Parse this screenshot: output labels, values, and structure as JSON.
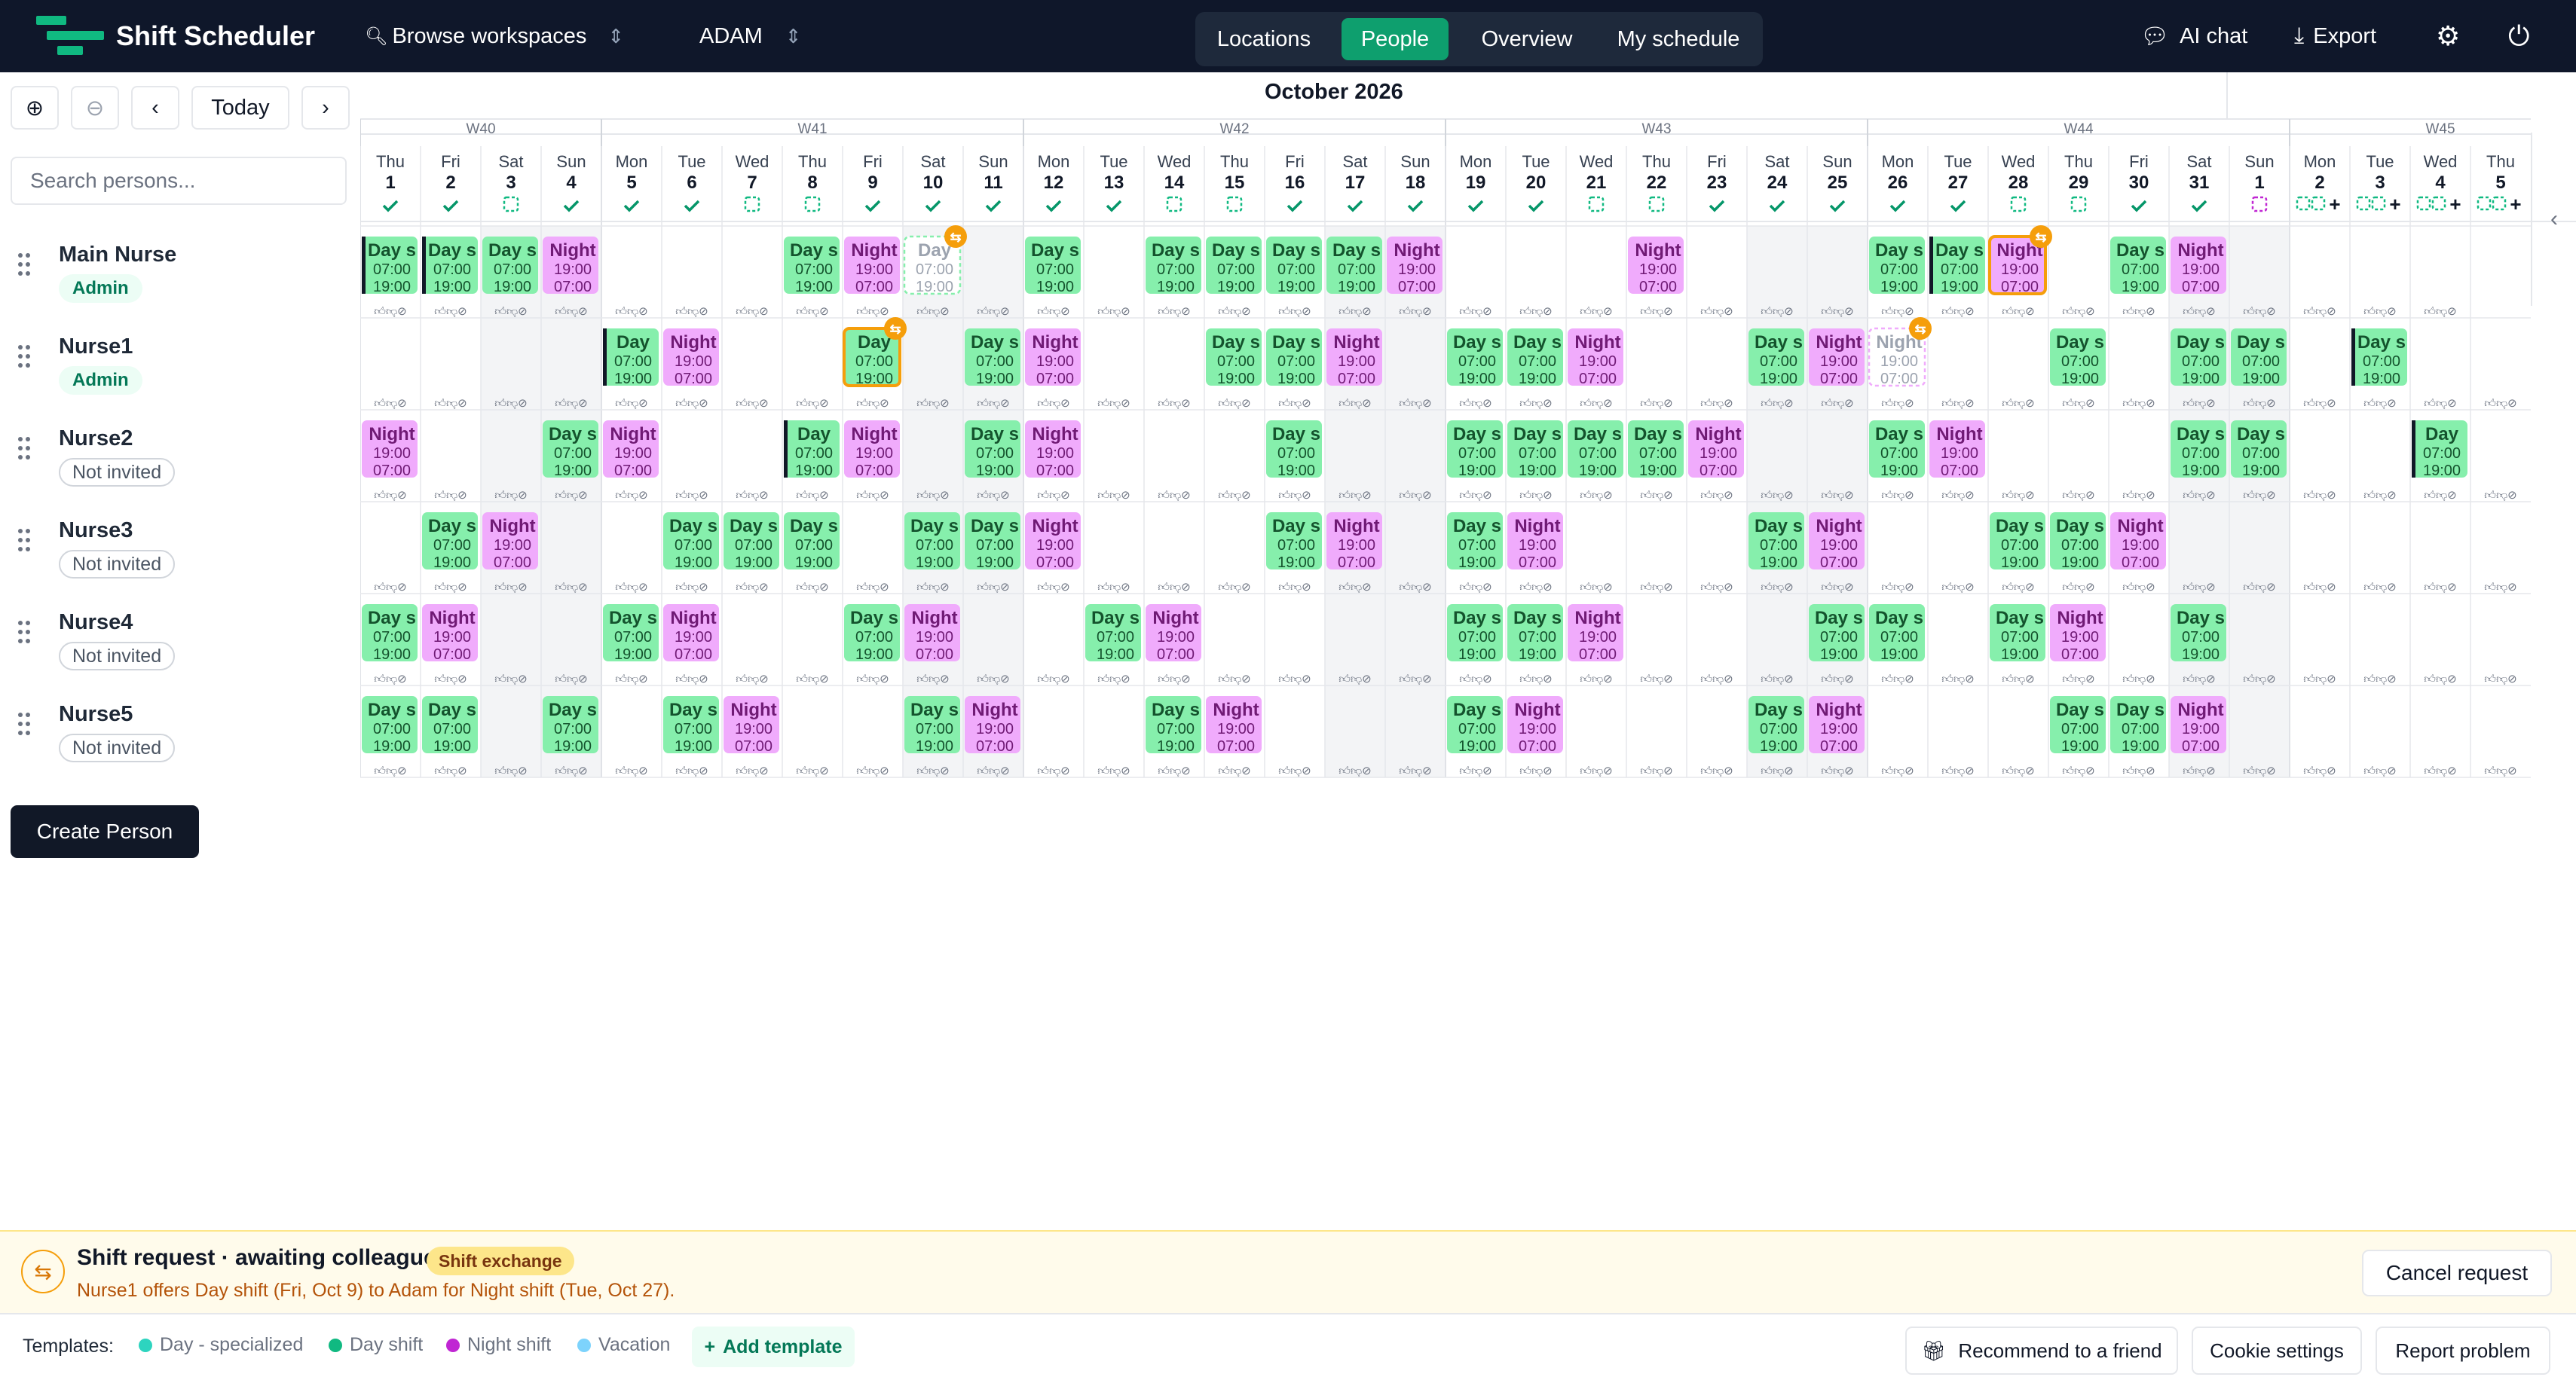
{
  "app": {
    "title": "Shift Scheduler"
  },
  "topbar": {
    "workspace_label": "Browse workspaces",
    "account_label": "ADAM",
    "ai_chat_label": "AI chat",
    "export_label": "Export"
  },
  "nav": {
    "tabs": [
      "Locations",
      "People",
      "Overview",
      "My schedule"
    ],
    "active": "People"
  },
  "controls": {
    "today_label": "Today",
    "search_placeholder": "Search persons..."
  },
  "calendar": {
    "month_title": "October 2026",
    "weeks": [
      {
        "label": "W40",
        "first": 0,
        "count": 4
      },
      {
        "label": "W41",
        "first": 4,
        "count": 7
      },
      {
        "label": "W42",
        "first": 11,
        "count": 7
      },
      {
        "label": "W43",
        "first": 18,
        "count": 7
      },
      {
        "label": "W44",
        "first": 25,
        "count": 7
      },
      {
        "label": "W45",
        "first": 32,
        "count": 5
      }
    ],
    "days": [
      {
        "dow": "Thu",
        "d": "1",
        "st": "ok"
      },
      {
        "dow": "Fri",
        "d": "2",
        "st": "ok"
      },
      {
        "dow": "Sat",
        "d": "3",
        "st": "pend",
        "we": true
      },
      {
        "dow": "Sun",
        "d": "4",
        "st": "ok",
        "we": true
      },
      {
        "dow": "Mon",
        "d": "5",
        "st": "ok"
      },
      {
        "dow": "Tue",
        "d": "6",
        "st": "ok"
      },
      {
        "dow": "Wed",
        "d": "7",
        "st": "pend"
      },
      {
        "dow": "Thu",
        "d": "8",
        "st": "pend"
      },
      {
        "dow": "Fri",
        "d": "9",
        "st": "ok"
      },
      {
        "dow": "Sat",
        "d": "10",
        "st": "ok",
        "we": true
      },
      {
        "dow": "Sun",
        "d": "11",
        "st": "ok",
        "we": true
      },
      {
        "dow": "Mon",
        "d": "12",
        "st": "ok"
      },
      {
        "dow": "Tue",
        "d": "13",
        "st": "ok"
      },
      {
        "dow": "Wed",
        "d": "14",
        "st": "pend"
      },
      {
        "dow": "Thu",
        "d": "15",
        "st": "pend"
      },
      {
        "dow": "Fri",
        "d": "16",
        "st": "ok"
      },
      {
        "dow": "Sat",
        "d": "17",
        "st": "ok",
        "we": true
      },
      {
        "dow": "Sun",
        "d": "18",
        "st": "ok",
        "we": true
      },
      {
        "dow": "Mon",
        "d": "19",
        "st": "ok"
      },
      {
        "dow": "Tue",
        "d": "20",
        "st": "ok"
      },
      {
        "dow": "Wed",
        "d": "21",
        "st": "pend"
      },
      {
        "dow": "Thu",
        "d": "22",
        "st": "pend"
      },
      {
        "dow": "Fri",
        "d": "23",
        "st": "ok"
      },
      {
        "dow": "Sat",
        "d": "24",
        "st": "ok",
        "we": true
      },
      {
        "dow": "Sun",
        "d": "25",
        "st": "ok",
        "we": true
      },
      {
        "dow": "Mon",
        "d": "26",
        "st": "ok"
      },
      {
        "dow": "Tue",
        "d": "27",
        "st": "ok"
      },
      {
        "dow": "Wed",
        "d": "28",
        "st": "pend"
      },
      {
        "dow": "Thu",
        "d": "29",
        "st": "pend"
      },
      {
        "dow": "Fri",
        "d": "30",
        "st": "ok"
      },
      {
        "dow": "Sat",
        "d": "31",
        "st": "ok",
        "we": true
      },
      {
        "dow": "Sun",
        "d": "1",
        "st": "pendm",
        "we": true
      },
      {
        "dow": "Mon",
        "d": "2",
        "st": "plus"
      },
      {
        "dow": "Tue",
        "d": "3",
        "st": "plus"
      },
      {
        "dow": "Wed",
        "d": "4",
        "st": "plus"
      },
      {
        "dow": "Thu",
        "d": "5",
        "st": "plus"
      }
    ]
  },
  "shift_types": {
    "D": {
      "label": "Day s",
      "start": "07:00",
      "end": "19:00",
      "color": "#86efac",
      "text": "#14532d"
    },
    "d": {
      "label": "Day",
      "start": "07:00",
      "end": "19:00",
      "color": "#86efac",
      "text": "#14532d"
    },
    "N": {
      "label": "Night",
      "start": "19:00",
      "end": "07:00",
      "color": "#f0abfc",
      "text": "#701a75"
    }
  },
  "people": [
    {
      "name": "Main Nurse",
      "badge": "Admin",
      "shifts": "DDDN...DN~.D.DDDDN...N...DD#.DN....",
      "marked": [
        0,
        1,
        26
      ]
    },
    {
      "name": "Nurse1",
      "badge": "Admin",
      "shifts": "....dN..#.DN..DDN.DDN..DN^..D.DD.D..",
      "marked": [
        4,
        33
      ]
    },
    {
      "name": "Nurse2",
      "badge": "Not invited",
      "shifts": "N..DN..dN.DN...D..DDDDN..DN...DD..d.",
      "marked": [
        7,
        34
      ]
    },
    {
      "name": "Nurse3",
      "badge": "Not invited",
      "shifts": ".DN..DDD.DDN...DN.DN...DN..DDN......",
      "marked": []
    },
    {
      "name": "Nurse4",
      "badge": "Not invited",
      "shifts": "DN..DN..DN..DN....DDN...DD.DN.D.....",
      "marked": []
    },
    {
      "name": "Nurse5",
      "badge": "Not invited",
      "shifts": "DD.D.DN..DN..DN...DN...DN...DDN.....",
      "marked": []
    }
  ],
  "actions": {
    "create_person_label": "Create Person"
  },
  "request_banner": {
    "title": "Shift request · awaiting colleague",
    "tag": "Shift exchange",
    "message": "Nurse1 offers Day shift (Fri, Oct 9) to Adam for Night shift (Tue, Oct 27).",
    "cancel_label": "Cancel request"
  },
  "templates": {
    "label": "Templates:",
    "items": [
      {
        "name": "Day - specialized",
        "color": "#2dd4bf"
      },
      {
        "name": "Day shift",
        "color": "#10b981"
      },
      {
        "name": "Night shift",
        "color": "#c026d3"
      },
      {
        "name": "Vacation",
        "color": "#7dd3fc"
      }
    ],
    "add_label": "Add template"
  },
  "footer": {
    "recommend_label": "Recommend to a friend",
    "cookie_label": "Cookie settings",
    "report_label": "Report problem"
  }
}
